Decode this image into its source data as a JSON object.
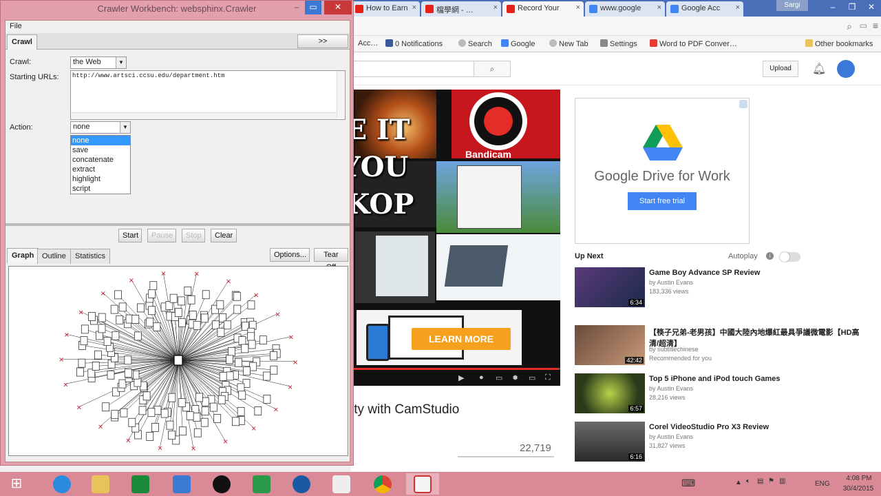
{
  "browser": {
    "tabs": [
      {
        "label": "How to Earn",
        "active": false
      },
      {
        "label": "檔學網 - …",
        "active": false
      },
      {
        "label": "Record Your",
        "active": true
      },
      {
        "label": "www.google",
        "active": false
      },
      {
        "label": "Google Acc",
        "active": false
      }
    ],
    "user_badge": "Sargi",
    "bookmarks": [
      "Acc…",
      "0 Notifications",
      "Search",
      "Google",
      "New Tab",
      "Settings",
      "Word to PDF Conver…",
      "Other bookmarks"
    ],
    "colors": {
      "tabstrip": "#4a6fb8",
      "youtube_red": "#e52d27"
    }
  },
  "youtube": {
    "search_button": "⌕",
    "upload": "Upload",
    "ad_text": "Google Drive for Work",
    "ad_button": "Start free trial",
    "learn_more": "LEARN MORE",
    "bandicam": "Bandicam",
    "video_title": "ity with CamStudio",
    "views": "22,719",
    "up_next": "Up Next",
    "autoplay": "Autoplay",
    "recommendations": [
      {
        "title": "Game Boy Advance SP Review",
        "by": "by Austin Evans",
        "views": "183,336 views",
        "duration": "6:34"
      },
      {
        "title": "【筷子兄弟-老男孩】中國大陸內地爆紅最具爭議微電影【HD高清/超清】",
        "by": "by subtitlechinese",
        "views": "Recommended for you",
        "duration": "42:42"
      },
      {
        "title": "Top 5 iPhone and iPod touch Games",
        "by": "by Austin Evans",
        "views": "28,216 views",
        "duration": "6:57"
      },
      {
        "title": "Corel VideoStudio Pro X3 Review",
        "by": "by Austin Evans",
        "views": "31,827 views",
        "duration": "6:16"
      }
    ]
  },
  "overlay": {
    "line1": "SAVE IT",
    "line2": "TO YOU",
    "line3": "DESKOP"
  },
  "crawler": {
    "title": "Crawler Workbench: websphinx.Crawler",
    "menu": "File",
    "tab_crawl": "Crawl",
    "advanced_button": ">> Advanced",
    "crawl_label": "Crawl:",
    "crawl_value": "the Web",
    "urls_label": "Starting URLs:",
    "urls_value": "http://www.artsci.ccsu.edu/department.htm",
    "action_label": "Action:",
    "action_value": "none",
    "action_options": [
      "none",
      "save",
      "concatenate",
      "extract",
      "highlight",
      "script"
    ],
    "buttons": {
      "start": "Start",
      "pause": "Pause",
      "stop": "Stop",
      "clear": "Clear"
    },
    "tabs": {
      "graph": "Graph",
      "outline": "Outline",
      "statistics": "Statistics"
    },
    "options_button": "Options...",
    "tearoff_button": "Tear Off",
    "colors": {
      "frame": "#e2a0ad"
    }
  },
  "taskbar": {
    "language": "ENG",
    "time": "4:08 PM",
    "date": "30/4/2015"
  }
}
